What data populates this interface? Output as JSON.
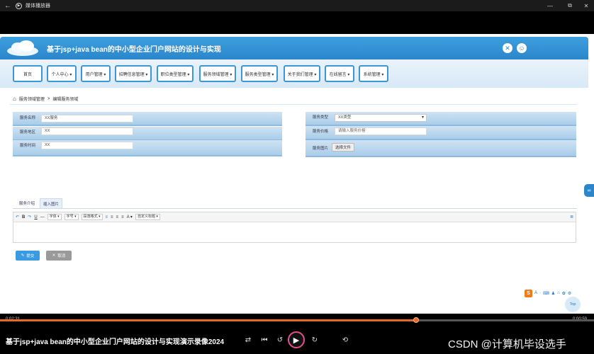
{
  "player": {
    "app_title": "媒体播放器",
    "back_glyph": "←",
    "app_icon_glyph": "▶",
    "window_controls": [
      "—",
      "⧉",
      "✕"
    ],
    "time_elapsed": "0:02:31",
    "time_remaining": "0:00:59",
    "progress_fraction": 0.7,
    "accent_color": "#e56a2a",
    "video_title": "基于jsp+java bean的中小型企业门户网站的设计与实现演示录像2024",
    "controls": {
      "shuffle": "⇄",
      "prev": "⏮",
      "rewind": "↺",
      "play": "▶",
      "forward": "↻",
      "repeat": "⟲"
    },
    "watermark": "CSDN @计算机毕设选手"
  },
  "site": {
    "title": "基于jsp+java bean的中小型企业门户网站的设计与实现",
    "brand_color": "#2b86cc",
    "header_icons": [
      "✕",
      "☺"
    ],
    "nav": [
      "首页",
      "个人中心 ▾",
      "用户管理 ▾",
      "招聘信息管理 ▾",
      "职位类型管理 ▾",
      "服务领域管理 ▾",
      "服务类型管理 ▾",
      "关于我们管理 ▾",
      "在线留言 ▾",
      "系统管理 ▾"
    ],
    "breadcrumb": {
      "home_icon": "⌂",
      "parent": "服务领域管理",
      "separator": ">",
      "current": "编辑服务领域"
    }
  },
  "form": {
    "name_label": "服务名称",
    "name_value": "XX服务",
    "region_label": "服务地区",
    "region_value": "XX",
    "time_label": "服务时间",
    "time_value": "XX",
    "type_label": "服务类型",
    "type_value": "XX类型",
    "price_label": "服务价格",
    "price_placeholder": "请输入服务价格",
    "image_label": "服务图片",
    "image_button": "选择文件",
    "tabs": [
      "服务介绍",
      "插入图片"
    ],
    "editor_tools": {
      "undo": "↶",
      "bold": "B",
      "redo": "↷",
      "underline": "U",
      "hr": "—",
      "font_select": "字体",
      "size_select": "字号",
      "para_select": "段落格式",
      "align_glyphs": [
        "≡",
        "≡",
        "≡",
        "≡"
      ],
      "color": "A",
      "custom_title": "自定义标题",
      "fullscreen": "≣"
    },
    "submit_label": "提交",
    "submit_icon": "✎",
    "cancel_label": "取消",
    "cancel_icon": "✕"
  },
  "overlay": {
    "side_icon": "∞",
    "ime_logo": "S",
    "ime_glyphs": [
      "A",
      "·",
      "⌨",
      "♟",
      "⌂",
      "✿",
      "⚙"
    ],
    "top_button": "Top"
  }
}
